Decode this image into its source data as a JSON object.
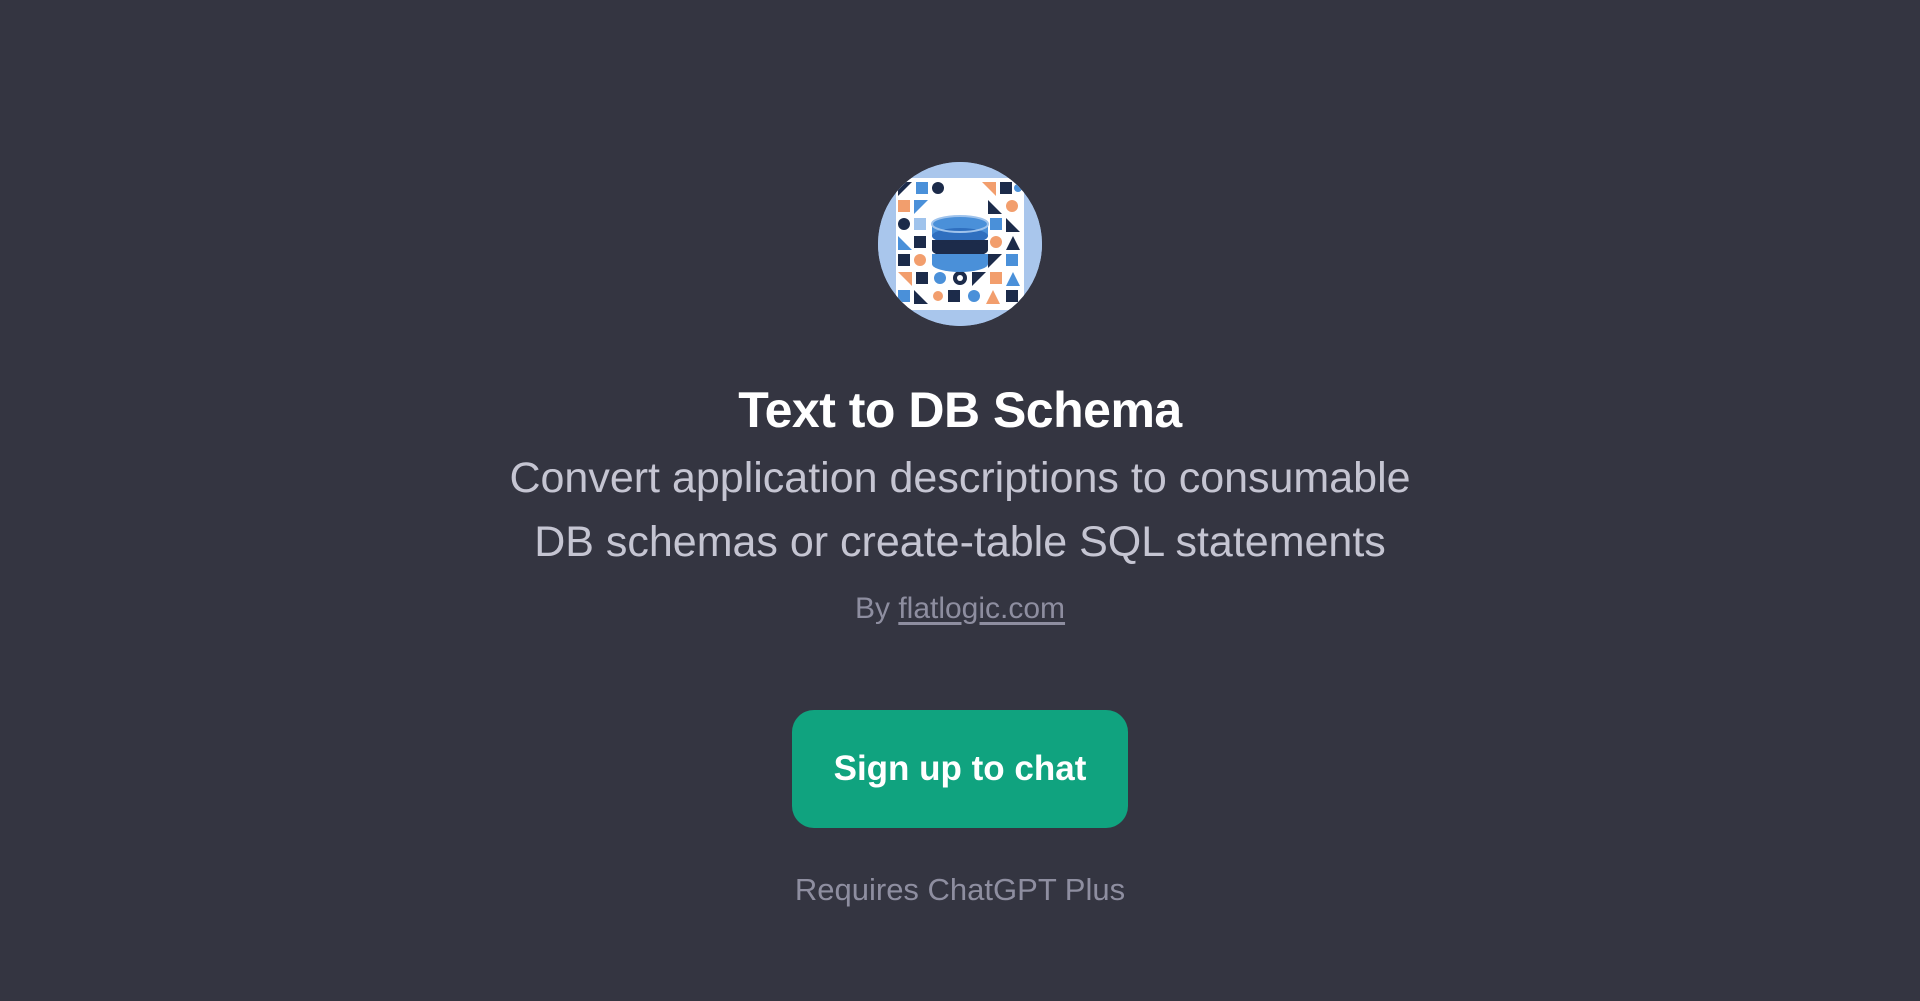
{
  "gpt": {
    "title": "Text to DB Schema",
    "description_line1": "Convert application descriptions to consumable",
    "description_line2": "DB schemas or create-table SQL statements",
    "by_prefix": "By",
    "author_link": "flatlogic.com"
  },
  "cta": {
    "label": "Sign up to chat"
  },
  "footer": {
    "requirement": "Requires ChatGPT Plus"
  },
  "colors": {
    "background": "#343541",
    "accent": "#10a37f",
    "title": "#ffffff",
    "description": "#c5c5d2",
    "muted": "#8e8ea0"
  },
  "icons": {
    "avatar": "database-icon"
  }
}
